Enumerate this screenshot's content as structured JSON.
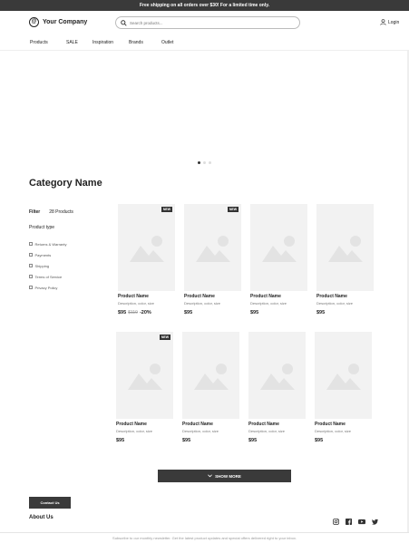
{
  "announcement": "Free shipping on all orders over $30!  For a limited time only.",
  "header": {
    "logo_glyph": "@",
    "company": "Your Company",
    "search_placeholder": "Search products...",
    "login": "Login"
  },
  "nav": [
    "Products",
    "SALE",
    "Inspiration",
    "Brands",
    "Outlet"
  ],
  "carousel": {
    "slides": 3,
    "active": 1
  },
  "category": {
    "title": "Category Name",
    "filter_label": "Filter",
    "count": "28 Products",
    "product_type_label": "Product type",
    "options": [
      "Returns & Warranty",
      "Payments",
      "Shipping",
      "Terms of Service",
      "Privacy Policy"
    ]
  },
  "products": [
    {
      "name": "Product Name",
      "desc": "Description, color, size",
      "price": "$95",
      "old": "$119",
      "disc": "-20%",
      "badge": "NEW"
    },
    {
      "name": "Product Name",
      "desc": "Description, color, size",
      "price": "$95",
      "old": "",
      "disc": "",
      "badge": "NEW"
    },
    {
      "name": "Product Name",
      "desc": "Description, color, size",
      "price": "$95",
      "old": "",
      "disc": "",
      "badge": ""
    },
    {
      "name": "Product Name",
      "desc": "Description, color, size",
      "price": "$95",
      "old": "",
      "disc": "",
      "badge": ""
    },
    {
      "name": "Product Name",
      "desc": "Description, color, size",
      "price": "$95",
      "old": "",
      "disc": "",
      "badge": "NEW"
    },
    {
      "name": "Product Name",
      "desc": "Description, color, size",
      "price": "$95",
      "old": "",
      "disc": "",
      "badge": ""
    },
    {
      "name": "Product Name",
      "desc": "Description, color, size",
      "price": "$95",
      "old": "",
      "disc": "",
      "badge": ""
    },
    {
      "name": "Product Name",
      "desc": "Description, color, size",
      "price": "$95",
      "old": "",
      "disc": "",
      "badge": ""
    }
  ],
  "show_more": "SHOW MORE",
  "footer": {
    "contact": "Contact Us",
    "about": "About Us",
    "social_icons": [
      "instagram-icon",
      "facebook-icon",
      "youtube-icon",
      "twitter-icon"
    ],
    "subscribe": "Subscribe to our monthly newsletter. Get the latest product updates and special offers delivered right to your inbox."
  },
  "colors": {
    "dark": "#3a3a3a",
    "placeholder": "#f2f2f2",
    "placeholder_shape": "#e3e3e3"
  }
}
